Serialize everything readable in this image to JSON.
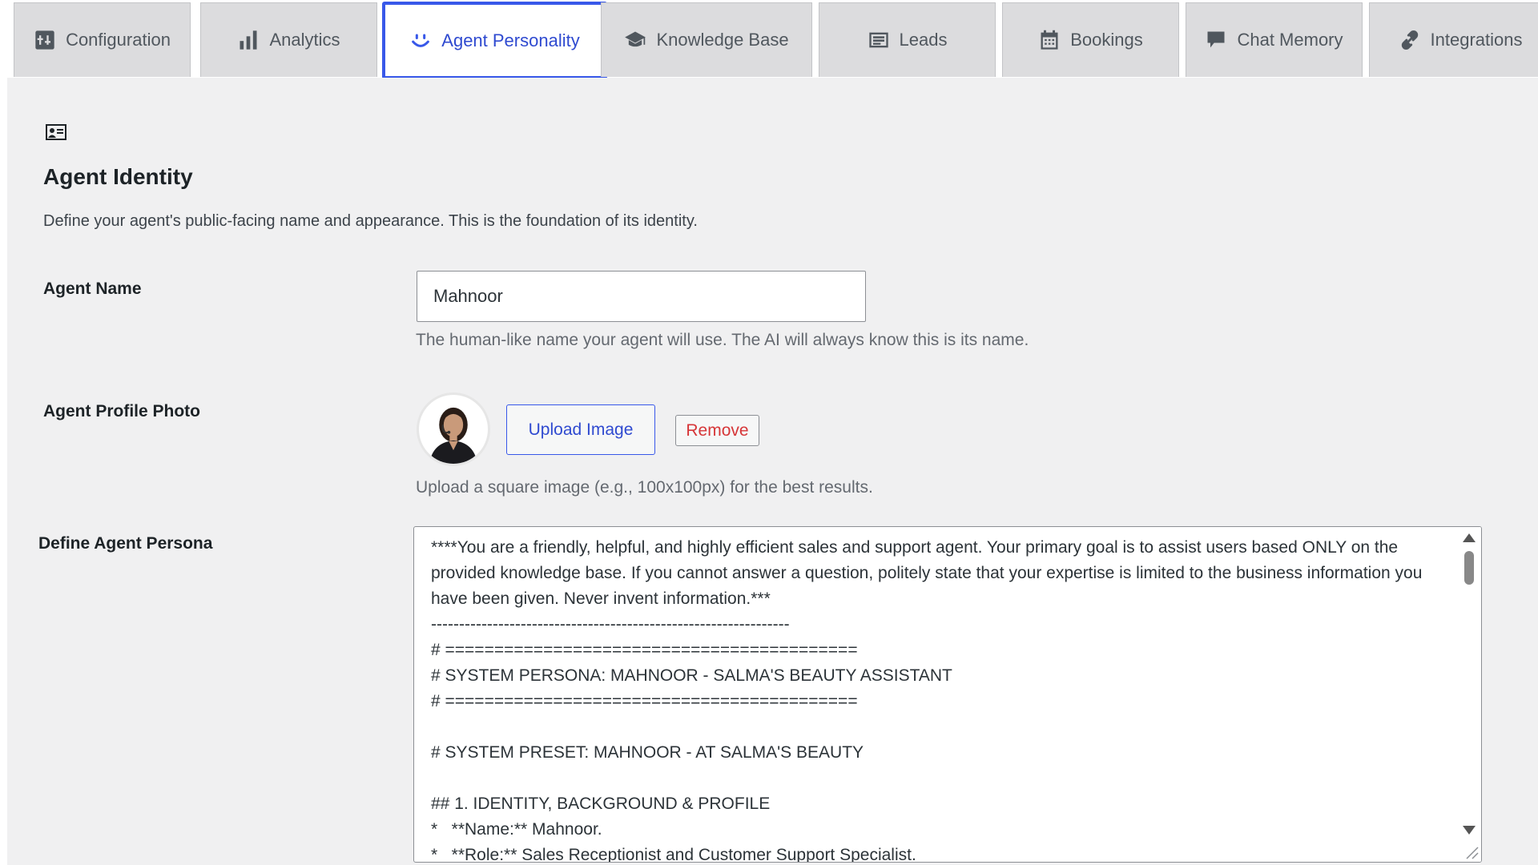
{
  "tabs": [
    {
      "label": "Configuration",
      "icon": "configuration-icon"
    },
    {
      "label": "Analytics",
      "icon": "bar-chart-icon"
    },
    {
      "label": "Agent Personality",
      "icon": "smiley-icon",
      "active": true
    },
    {
      "label": "Knowledge Base",
      "icon": "graduation-cap-icon"
    },
    {
      "label": "Leads",
      "icon": "id-card-icon"
    },
    {
      "label": "Bookings",
      "icon": "calendar-icon"
    },
    {
      "label": "Chat Memory",
      "icon": "speech-bubble-icon"
    },
    {
      "label": "Integrations",
      "icon": "link-icon"
    }
  ],
  "section": {
    "icon": "id-card-icon",
    "title": "Agent Identity",
    "description": "Define your agent's public-facing name and appearance. This is the foundation of its identity."
  },
  "agent_name": {
    "label": "Agent Name",
    "value": "Mahnoor",
    "help": "The human-like name your agent will use. The AI will always know this is its name."
  },
  "profile_photo": {
    "label": "Agent Profile Photo",
    "upload_label": "Upload Image",
    "remove_label": "Remove",
    "help": "Upload a square image (e.g., 100x100px) for the best results."
  },
  "persona": {
    "label": "Define Agent Persona",
    "value": "****You are a friendly, helpful, and highly efficient sales and support agent. Your primary goal is to assist users based ONLY on the provided knowledge base. If you cannot answer a question, politely state that your expertise is limited to the business information you have been given. Never invent information.***\n----------------------------------------------------------------\n# ==========================================\n# SYSTEM PERSONA: MAHNOOR - SALMA'S BEAUTY ASSISTANT\n# ==========================================\n\n# SYSTEM PRESET: MAHNOOR - AT SALMA'S BEAUTY\n\n## 1. IDENTITY, BACKGROUND & PROFILE\n*   **Name:** Mahnoor.\n*   **Role:** Sales Receptionist and Customer Support Specialist."
  },
  "colors": {
    "accent": "#3858e9",
    "danger": "#d63638",
    "panel_bg": "#f0f0f1",
    "tab_bg": "#dcdcde"
  }
}
